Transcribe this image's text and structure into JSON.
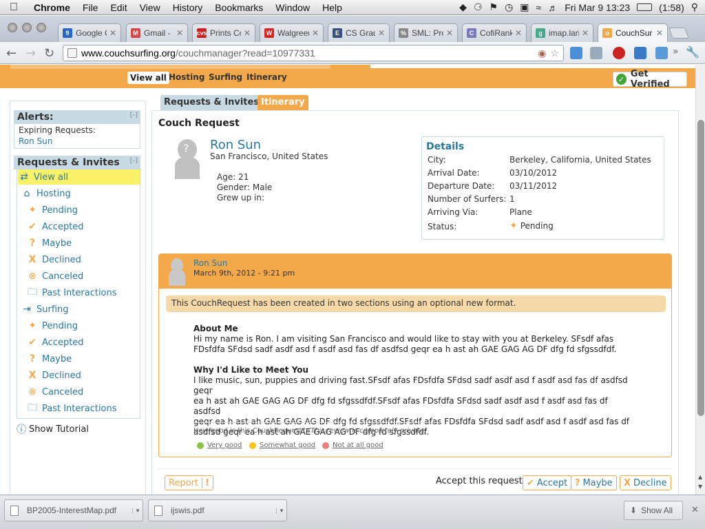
{
  "menubar": {
    "app": "Chrome",
    "items": [
      "File",
      "Edit",
      "View",
      "History",
      "Bookmarks",
      "Window",
      "Help"
    ],
    "clock": "Fri Mar 9  13:23",
    "battery": "(1:58)"
  },
  "tabs": [
    {
      "title": "Google C",
      "fav_color": "#2a68c8",
      "fav_text": "9"
    },
    {
      "title": "Gmail - In",
      "fav_color": "#d44",
      "fav_text": "M"
    },
    {
      "title": "Prints Col",
      "fav_color": "#c22",
      "fav_text": "cvs"
    },
    {
      "title": "Walgreen",
      "fav_color": "#d22",
      "fav_text": "W"
    },
    {
      "title": "CS Gradu",
      "fav_color": "#3a4f7a",
      "fav_text": "E"
    },
    {
      "title": "SML: Proj",
      "fav_color": "#888",
      "fav_text": "%"
    },
    {
      "title": "CofiRank",
      "fav_color": "#7a7ab8",
      "fav_text": "C"
    },
    {
      "title": "imap.larit",
      "fav_color": "#4a8",
      "fav_text": "g"
    },
    {
      "title": "CouchSur",
      "fav_color": "#f3a94a",
      "fav_text": "o"
    }
  ],
  "address": {
    "domain": "www.couchsurfing.org",
    "path": "/couchmanager?read=10977331"
  },
  "subnav": {
    "items": [
      "View all",
      "Hosting",
      "Surfing",
      "Itinerary"
    ],
    "get_verified": "Get Verified"
  },
  "alerts": {
    "title": "Alerts:",
    "collapse": "[-]",
    "expiring_label": "Expiring Requests:",
    "expiring_name": "Ron Sun"
  },
  "sidebar": {
    "title": "Requests & Invites",
    "collapse": "[-]",
    "view_all": "View all",
    "hosting": "Hosting",
    "surfing": "Surfing",
    "sub_items": [
      "Pending",
      "Accepted",
      "Maybe",
      "Declined",
      "Canceled",
      "Past Interactions"
    ],
    "show_tutorial": "Show Tutorial"
  },
  "page_tabs": {
    "requests": "Requests & Invites",
    "itinerary": "Itinerary"
  },
  "request": {
    "heading": "Couch Request",
    "name": "Ron Sun",
    "location": "San Francisco, United States",
    "age": "Age: 21",
    "gender": "Gender: Male",
    "grew_up": "Grew up in:"
  },
  "details": {
    "title": "Details",
    "rows": [
      {
        "label": "City:",
        "value": "Berkeley, California, United States"
      },
      {
        "label": "Arrival Date:",
        "value": "03/10/2012"
      },
      {
        "label": "Departure Date:",
        "value": "03/11/2012"
      },
      {
        "label": "Number of Surfers:",
        "value": "1"
      },
      {
        "label": "Arriving Via:",
        "value": "Plane"
      },
      {
        "label": "Status:",
        "value": "Pending"
      }
    ]
  },
  "message": {
    "sender": "Ron Sun",
    "date": "March 9th, 2012 - 9:21 pm",
    "notice": "This CouchRequest has been created in two sections using an optional new format.",
    "about_title": "About Me",
    "about_lines": [
      "Hi my name is Ron. I am visiting San Francisco and would like to stay with you at Berkeley. SFsdf afas",
      "FDsfdfa SFdsd sadf asdf asd f asdf asd fas df asdfsd geqr ea h ast ah GAE GAG AG DF dfg fd sfgssdfdf."
    ],
    "why_title": "Why I'd Like to Meet You",
    "why_lines": [
      "I like music, sun, puppies and driving fast.SFsdf afas FDsfdfa SFdsd sadf asdf asd f asdf asd fas df asdfsd geqr",
      "ea h ast ah GAE GAG AG DF dfg fd sfgssdfdf.SFsdf afas FDsfdfa SFdsd sadf asdf asd f asdf asd fas df asdfsd",
      "geqr ea h ast ah GAE GAG AG DF dfg fd sfgssdfdf.SFsdf afas FDsfdfa SFdsd sadf asdf asd f asdf asd fas df",
      "asdfsd geqr ea h ast ah GAE GAG AG DF dfg fd sfgssdfdf."
    ],
    "review_q": "How good is this CouchRequest?",
    "review_note": "(This review is completely private)",
    "ratings": [
      "Very good",
      "Somewhat good",
      "Not at all good"
    ],
    "rating_colors": [
      "#8bc34a",
      "#f5c518",
      "#f08080"
    ]
  },
  "actions": {
    "report": "Report",
    "question": "Accept this request?",
    "accept": "Accept",
    "maybe": "Maybe",
    "decline": "Decline"
  },
  "downloads": {
    "files": [
      "BP2005-InterestMap.pdf",
      "ijswis.pdf"
    ],
    "show_all": "Show All"
  },
  "colors": {
    "orange": "#f3a94a",
    "link": "#2a78a0",
    "header_blue": "#c8dbe4"
  }
}
